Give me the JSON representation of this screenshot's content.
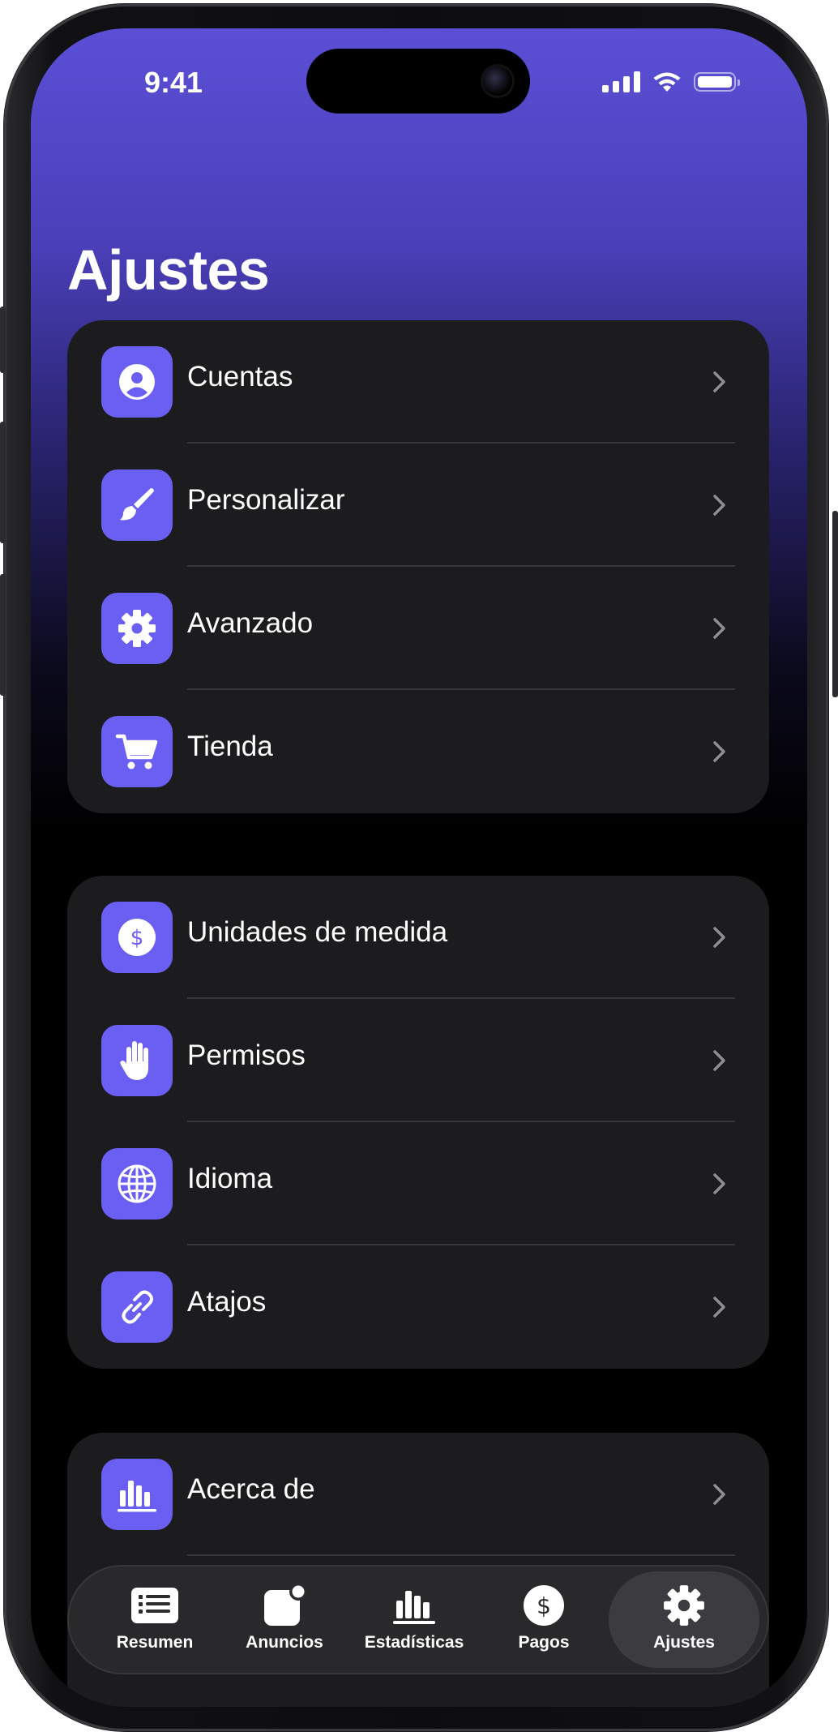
{
  "status": {
    "time": "9:41"
  },
  "page": {
    "title": "Ajustes"
  },
  "groups": [
    {
      "items": [
        {
          "label": "Cuentas",
          "icon": "person-circle-icon"
        },
        {
          "label": "Personalizar",
          "icon": "paintbrush-icon"
        },
        {
          "label": "Avanzado",
          "icon": "gear-icon"
        },
        {
          "label": "Tienda",
          "icon": "cart-icon"
        }
      ]
    },
    {
      "items": [
        {
          "label": "Unidades de medida",
          "icon": "dollar-circle-icon"
        },
        {
          "label": "Permisos",
          "icon": "hand-icon"
        },
        {
          "label": "Idioma",
          "icon": "globe-icon"
        },
        {
          "label": "Atajos",
          "icon": "link-icon"
        }
      ]
    },
    {
      "items": [
        {
          "label": "Acerca de",
          "icon": "chart-bars-icon"
        }
      ]
    }
  ],
  "tabbar": {
    "tabs": [
      {
        "label": "Resumen",
        "icon": "list-icon"
      },
      {
        "label": "Anuncios",
        "icon": "app-badge-icon"
      },
      {
        "label": "Estadísticas",
        "icon": "chart-bars-icon"
      },
      {
        "label": "Pagos",
        "icon": "dollar-circle-icon"
      },
      {
        "label": "Ajustes",
        "icon": "gear-icon",
        "selected": true
      }
    ]
  },
  "colors": {
    "accent": "#6b5ef2",
    "group_bg": "#1c1c1e",
    "separator": "#38383a"
  }
}
